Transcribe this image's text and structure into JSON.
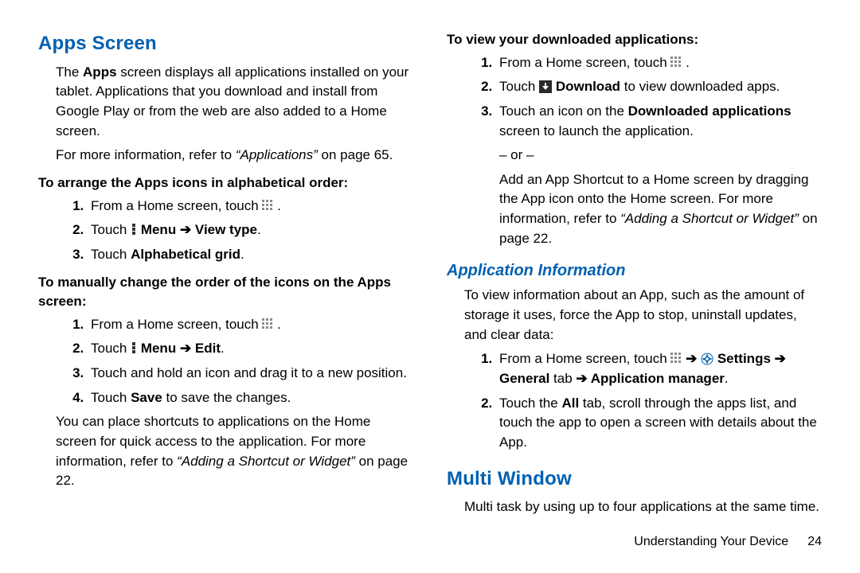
{
  "left": {
    "h1": "Apps Screen",
    "intro_pre": "The ",
    "intro_bold1": "Apps",
    "intro_post": " screen displays all applications installed on your tablet. Applications that you download and install from Google Play or from the web are also added to a Home screen.",
    "refer1_pre": "For more information, refer to ",
    "refer1_i": "“Applications”",
    "refer1_post": " on page 65.",
    "sub1": "To arrange the Apps icons in alphabetical order:",
    "s1_1_pre": "From a Home screen, touch ",
    "s1_1_post": " .",
    "s1_2_pre": "Touch ",
    "s1_2_b1": " Menu ",
    "s1_2_arrow": "➔ ",
    "s1_2_b2": "View type",
    "s1_2_post": ".",
    "s1_3_pre": "Touch ",
    "s1_3_b": "Alphabetical grid",
    "s1_3_post": ".",
    "sub2": "To manually change the order of the icons on the Apps screen:",
    "s2_1_pre": "From a Home screen, touch ",
    "s2_1_post": " .",
    "s2_2_pre": "Touch ",
    "s2_2_b1": " Menu ",
    "s2_2_arrow": "➔ ",
    "s2_2_b2": "Edit",
    "s2_2_post": ".",
    "s2_3": "Touch and hold an icon and drag it to a new position.",
    "s2_4_pre": "Touch ",
    "s2_4_b": "Save",
    "s2_4_post": " to save the changes.",
    "para2_pre": "You can place shortcuts to applications on the Home screen for quick access to the application. For more information, refer to ",
    "para2_i": "“Adding a Shortcut or Widget”",
    "para2_post": " on page 22."
  },
  "right": {
    "sub1": "To view your downloaded applications:",
    "d1_1_pre": "From a Home screen, touch ",
    "d1_1_post": " .",
    "d1_2_pre": "Touch ",
    "d1_2_b": " Download",
    "d1_2_post": " to view downloaded apps.",
    "d1_3_pre": "Touch an icon on the ",
    "d1_3_b": "Downloaded applications",
    "d1_3_post": " screen to launch the application.",
    "or": "– or –",
    "d1_or_pre": "Add an App Shortcut to a Home screen by dragging the App icon onto the Home screen. For more information, refer to ",
    "d1_or_i": "“Adding a Shortcut or Widget”",
    "d1_or_post": " on page 22.",
    "h2": "Application Information",
    "ai_intro": "To view information about an App, such as the amount of storage it uses, force the App to stop, uninstall updates, and clear data:",
    "ai_1_pre": "From a Home screen, touch ",
    "ai_1_arrow1": " ➔ ",
    "ai_1_b1": " Settings ",
    "ai_1_arrow2": "➔ ",
    "ai_1_b2": "General",
    "ai_1_mid": " tab ",
    "ai_1_arrow3": "➔ ",
    "ai_1_b3": "Application manager",
    "ai_1_post": ".",
    "ai_2_pre": "Touch the ",
    "ai_2_b": "All",
    "ai_2_post": " tab, scroll through the apps list, and touch the app to open a screen with details about the App.",
    "h1_mw": "Multi Window",
    "mw_intro": "Multi task by using up to four applications at the same time."
  },
  "footer": {
    "chapter": "Understanding Your Device",
    "page": "24"
  }
}
